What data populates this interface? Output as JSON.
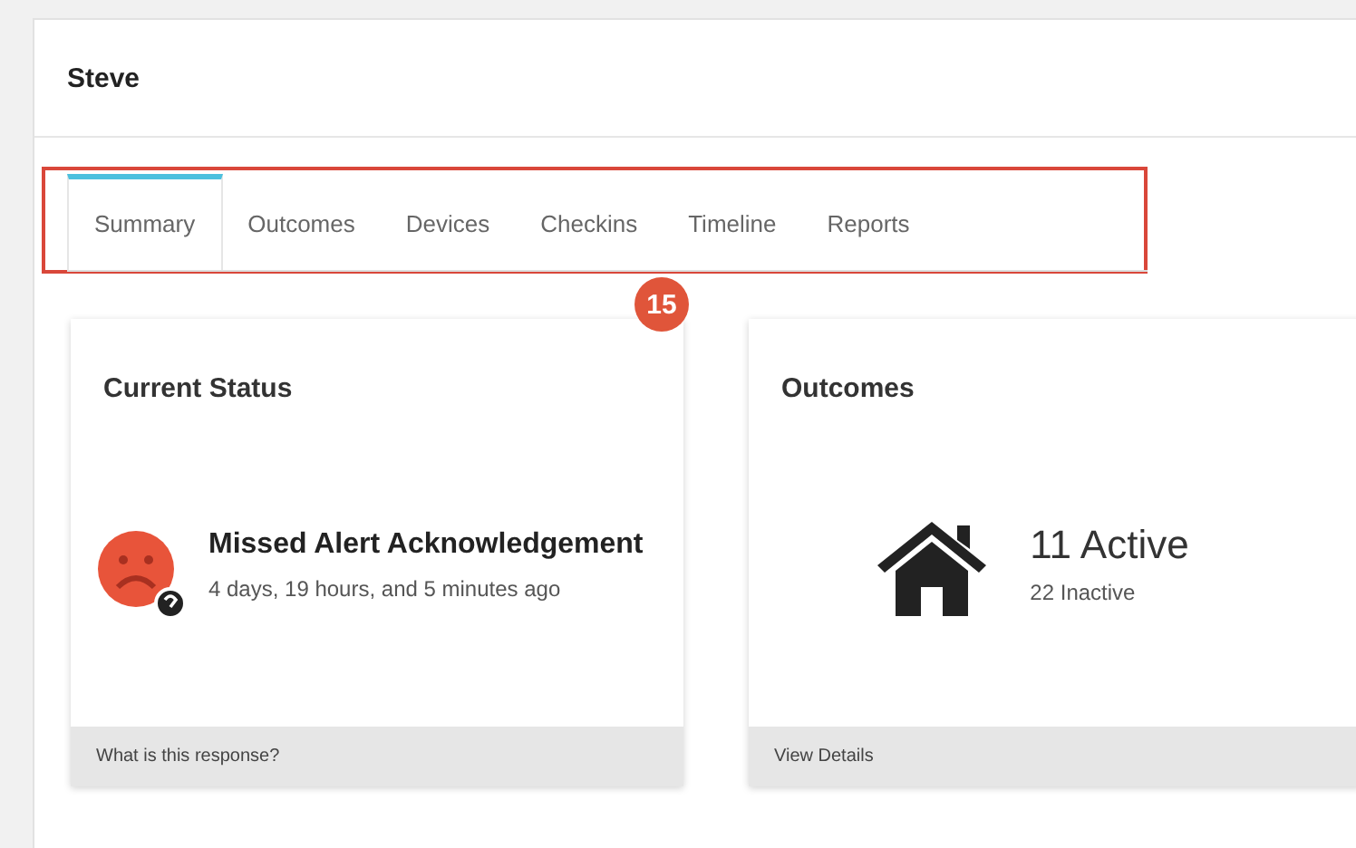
{
  "header": {
    "title": "Steve"
  },
  "tabs": [
    {
      "label": "Summary",
      "selected": true
    },
    {
      "label": "Outcomes",
      "selected": false
    },
    {
      "label": "Devices",
      "selected": false
    },
    {
      "label": "Checkins",
      "selected": false
    },
    {
      "label": "Timeline",
      "selected": false
    },
    {
      "label": "Reports",
      "selected": false
    }
  ],
  "callout": {
    "number": "15"
  },
  "cards": [
    {
      "kind": "status",
      "title": "Current Status",
      "headline": "Missed Alert Acknowledgement",
      "detail": "4 days, 19 hours, and 5 minutes ago",
      "footer": "What is this response?"
    },
    {
      "kind": "outcomes",
      "title": "Outcomes",
      "headline": "11 Active",
      "detail": "22 Inactive",
      "footer": "View Details"
    }
  ]
}
